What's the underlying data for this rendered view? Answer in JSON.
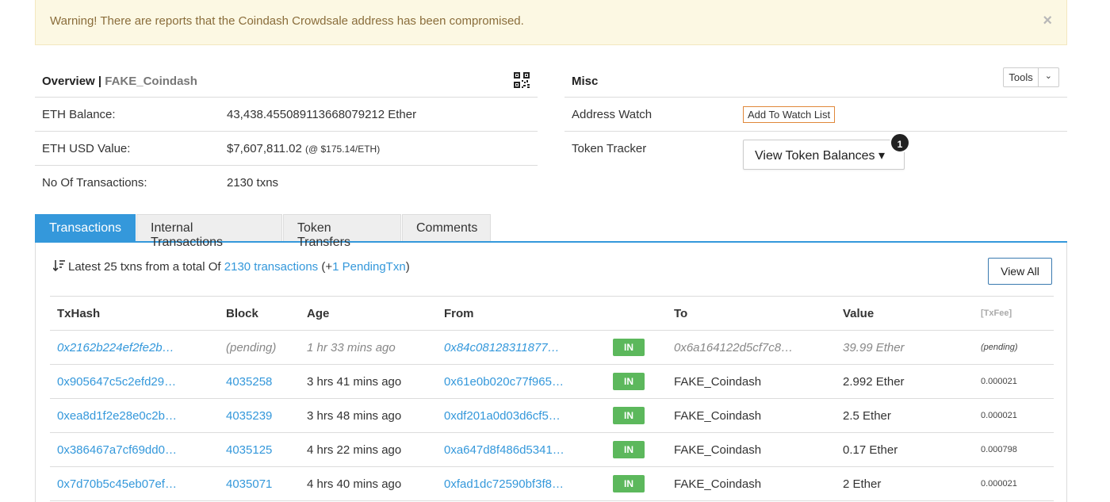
{
  "alert": {
    "text": "Warning! There are reports that the Coindash Crowdsale address has been compromised.",
    "close": "×"
  },
  "overview": {
    "title": "Overview |",
    "subtitle": "FAKE_Coindash",
    "rows": [
      {
        "label": "ETH Balance:",
        "value": "43,438.455089113668079212 Ether"
      },
      {
        "label": "ETH USD Value:",
        "value": "$7,607,811.02",
        "note": "(@ $175.14/ETH)"
      },
      {
        "label": "No Of Transactions:",
        "value": "2130 txns"
      }
    ]
  },
  "misc": {
    "title": "Misc",
    "tools_label": "Tools",
    "tools_caret": "⌄",
    "address_watch_label": "Address Watch",
    "watch_button": "Add To Watch List",
    "token_tracker_label": "Token Tracker",
    "token_button": "View Token Balances ▾",
    "token_badge": "1"
  },
  "tabs": [
    "Transactions",
    "Internal Transactions",
    "Token Transfers",
    "Comments"
  ],
  "summary": {
    "prefix": "Latest 25 txns from a total Of",
    "link": "2130 transactions",
    "mid": "(+",
    "pending_link": "1 PendingTxn",
    "suffix": ")"
  },
  "view_all": "View All",
  "table": {
    "headers": [
      "TxHash",
      "Block",
      "Age",
      "From",
      "",
      "To",
      "Value",
      "[TxFee]"
    ],
    "rows": [
      {
        "hash": "0x2162b224ef2fe2b…",
        "block": "(pending)",
        "age": "1 hr 33 mins ago",
        "from": "0x84c08128311877…",
        "dir": "IN",
        "to": "0x6a164122d5cf7c8…",
        "value": "39.99 Ether",
        "fee": "(pending)",
        "pending": true
      },
      {
        "hash": "0x905647c5c2efd29…",
        "block": "4035258",
        "age": "3 hrs 41 mins ago",
        "from": "0x61e0b020c77f965…",
        "dir": "IN",
        "to": "FAKE_Coindash",
        "value": "2.992 Ether",
        "fee": "0.000021"
      },
      {
        "hash": "0xea8d1f2e28e0c2b…",
        "block": "4035239",
        "age": "3 hrs 48 mins ago",
        "from": "0xdf201a0d03d6cf5…",
        "dir": "IN",
        "to": "FAKE_Coindash",
        "value": "2.5 Ether",
        "fee": "0.000021"
      },
      {
        "hash": "0x386467a7cf69dd0…",
        "block": "4035125",
        "age": "4 hrs 22 mins ago",
        "from": "0xa647d8f486d5341…",
        "dir": "IN",
        "to": "FAKE_Coindash",
        "value": "0.17 Ether",
        "fee": "0.000798"
      },
      {
        "hash": "0x7d70b5c45eb07ef…",
        "block": "4035071",
        "age": "4 hrs 40 mins ago",
        "from": "0xfad1dc72590bf3f8…",
        "dir": "IN",
        "to": "FAKE_Coindash",
        "value": "2 Ether",
        "fee": "0.000021"
      }
    ]
  },
  "colors": {
    "accent": "#3498db",
    "in_badge": "#5cb85c",
    "alert_bg": "#fcf8e3",
    "watch_border": "#e0883a"
  },
  "icons": {
    "qr": "qr-code-icon",
    "sort": "sort-icon",
    "close": "close-icon"
  }
}
